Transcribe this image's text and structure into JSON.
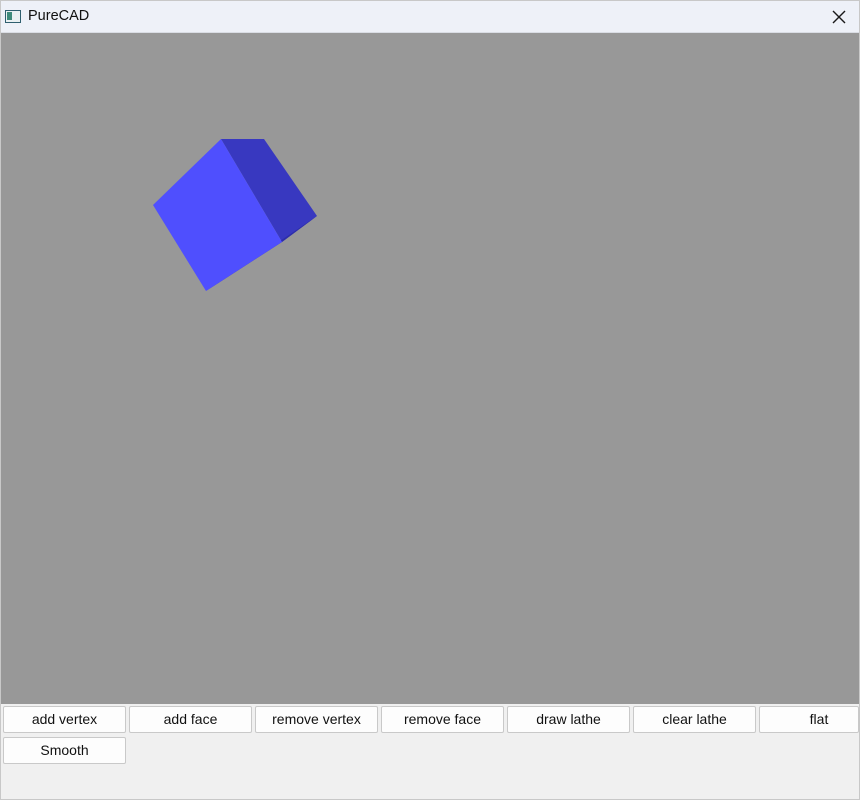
{
  "window": {
    "title": "PureCAD",
    "close_icon": "close-icon",
    "app_icon": "window-app-icon"
  },
  "viewport": {
    "background": "#989898",
    "object": "cube",
    "face_colors": [
      "#4f4ffe",
      "#3838c0",
      "#2e2eaa"
    ]
  },
  "toolbar": {
    "buttons": [
      {
        "label": "add vertex"
      },
      {
        "label": "add face"
      },
      {
        "label": "remove vertex"
      },
      {
        "label": "remove face"
      },
      {
        "label": "draw lathe"
      },
      {
        "label": "clear lathe"
      },
      {
        "label": "flat"
      },
      {
        "label": "Smooth"
      }
    ]
  }
}
